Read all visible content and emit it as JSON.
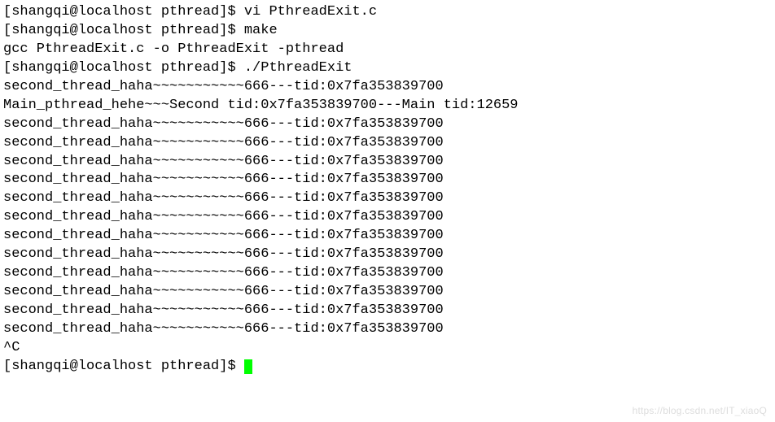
{
  "prompt": "[shangqi@localhost pthread]$ ",
  "commands": {
    "vi": "vi PthreadExit.c",
    "make": "make",
    "run": "./PthreadExit"
  },
  "output": {
    "gcc": "gcc PthreadExit.c -o PthreadExit -pthread",
    "second_line": "second_thread_haha~~~~~~~~~~~666---tid:0x7fa353839700",
    "main_line": "Main_pthread_hehe~~~Second tid:0x7fa353839700---Main tid:12659",
    "interrupt": "^C"
  },
  "watermark": "https://blog.csdn.net/IT_xiaoQ"
}
